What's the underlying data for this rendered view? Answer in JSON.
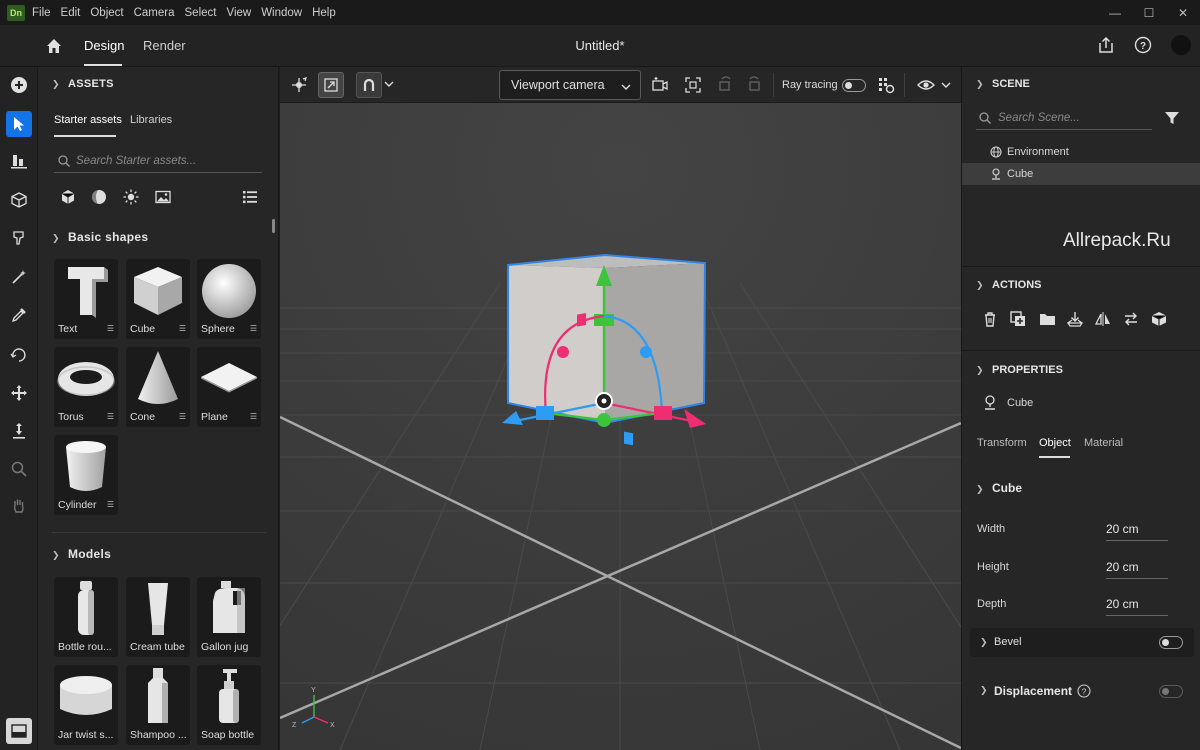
{
  "app": {
    "logo": "Dn",
    "menus": [
      "File",
      "Edit",
      "Object",
      "Camera",
      "Select",
      "View",
      "Window",
      "Help"
    ],
    "window_controls": [
      "—",
      "☐",
      "✕"
    ]
  },
  "topbar": {
    "tabs": [
      "Design",
      "Render"
    ],
    "document_title": "Untitled*"
  },
  "assets": {
    "title": "ASSETS",
    "tabs": [
      "Starter assets",
      "Libraries"
    ],
    "search_placeholder": "Search Starter assets...",
    "basic_shapes_title": "Basic shapes",
    "basic_shapes": [
      "Text",
      "Cube",
      "Sphere",
      "Torus",
      "Cone",
      "Plane",
      "Cylinder"
    ],
    "models_title": "Models",
    "models": [
      "Bottle rou...",
      "Cream tube",
      "Gallon jug",
      "Jar twist s...",
      "Shampoo ...",
      "Soap bottle"
    ]
  },
  "viewport": {
    "camera_label": "Viewport camera",
    "ray_tracing_label": "Ray tracing",
    "axes": {
      "x": "X",
      "y": "Y",
      "z": "Z"
    }
  },
  "scene": {
    "title": "SCENE",
    "search_placeholder": "Search Scene...",
    "items": [
      "Environment",
      "Cube"
    ],
    "watermark": "Allrepack.Ru"
  },
  "actions": {
    "title": "ACTIONS"
  },
  "properties": {
    "title": "PROPERTIES",
    "selected": "Cube",
    "tabs": [
      "Transform",
      "Object",
      "Material"
    ],
    "group": "Cube",
    "width_label": "Width",
    "width_value": "20 cm",
    "height_label": "Height",
    "height_value": "20 cm",
    "depth_label": "Depth",
    "depth_value": "20 cm",
    "bevel_label": "Bevel",
    "displacement_label": "Displacement"
  },
  "colors": {
    "accent": "#1473e6",
    "gizmo_green": "#3cc43c",
    "gizmo_blue": "#2d9cf5",
    "gizmo_red": "#ee2d72",
    "bounding_box": "#2f86e8"
  }
}
